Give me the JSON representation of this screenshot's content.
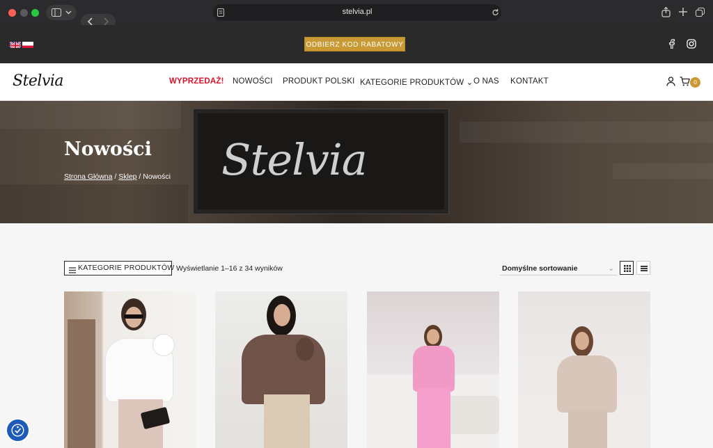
{
  "browser": {
    "url": "stelvia.pl"
  },
  "topbar": {
    "promo_button": "ODBIERZ KOD RABATOWY",
    "languages": [
      "English",
      "Polski"
    ]
  },
  "header": {
    "logo": "Stelvia",
    "nav": [
      {
        "label": "WYPRZEDAŻ!"
      },
      {
        "label": "NOWOŚCI"
      },
      {
        "label": "PRODUKT POLSKI"
      },
      {
        "label": "KATEGORIE PRODUKTÓW ⌄"
      },
      {
        "label": "O NAS"
      },
      {
        "label": "KONTAKT"
      }
    ],
    "cart_count": "0"
  },
  "hero": {
    "title": "Nowości",
    "sign_text": "Stelvia",
    "breadcrumb": {
      "home": "Strona Główna",
      "sep1": " / ",
      "shop": "Sklep",
      "sep2": " / ",
      "current": "Nowości"
    }
  },
  "shop": {
    "categories_button": "KATEGORIE PRODUKTÓW",
    "results_text": "Wyświetlanie 1–16 z 34 wyników",
    "sort_selected": "Domyślne sortowanie"
  },
  "colors": {
    "accent": "#c99a33",
    "sale": "#e0112b",
    "topbar": "#2a2a2a",
    "a11y": "#1e5bb8"
  },
  "icons": [
    "facebook-icon",
    "instagram-icon",
    "account-icon",
    "cart-icon",
    "grid-view-icon",
    "list-view-icon",
    "accessibility-icon"
  ]
}
